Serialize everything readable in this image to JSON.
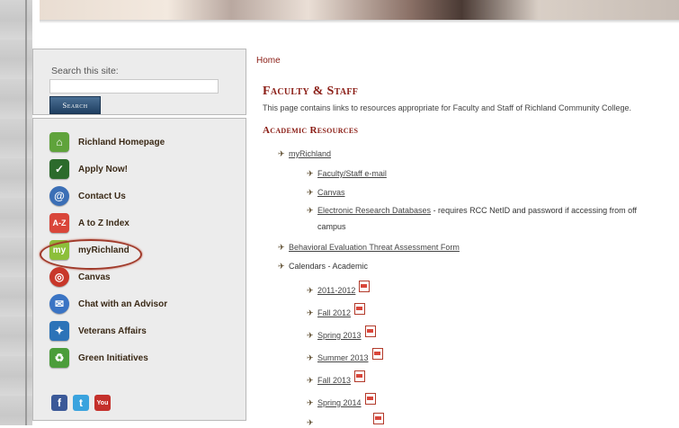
{
  "search": {
    "label": "Search this site:",
    "placeholder": "",
    "button_label": "Search"
  },
  "sidebar": {
    "items": [
      {
        "label": "Richland Homepage",
        "icon": "home-icon",
        "color": "#5fa33b"
      },
      {
        "label": "Apply Now!",
        "icon": "checkmark-icon",
        "color": "#2c6b2c"
      },
      {
        "label": "Contact Us",
        "icon": "at-sign-icon",
        "color": "#3b6fb6"
      },
      {
        "label": "A to Z Index",
        "icon": "az-index-icon",
        "color": "#d9463a"
      },
      {
        "label": "myRichland",
        "icon": "myrichland-icon",
        "color": "#8cbf3a"
      },
      {
        "label": "Canvas",
        "icon": "canvas-icon",
        "color": "#c8372a"
      },
      {
        "label": "Chat with an Advisor",
        "icon": "chat-icon",
        "color": "#3a74c4"
      },
      {
        "label": "Veterans Affairs",
        "icon": "ribbon-icon",
        "color": "#2c73b8"
      },
      {
        "label": "Green Initiatives",
        "icon": "recycle-icon",
        "color": "#4b9d3a"
      }
    ],
    "social": [
      {
        "label": "f",
        "icon": "facebook-icon",
        "color": "#3b5998"
      },
      {
        "label": "t",
        "icon": "twitter-icon",
        "color": "#3aa3de"
      },
      {
        "label": "You",
        "icon": "youtube-icon",
        "color": "#c4302b"
      }
    ]
  },
  "main": {
    "breadcrumb": "Home",
    "title": "Faculty & Staff",
    "description": "This page contains links to resources appropriate for Faculty and Staff of Richland Community College.",
    "section_heading": "Academic Resources",
    "items": {
      "myrichland": "myRichland",
      "email": "Faculty/Staff e-mail",
      "canvas": "Canvas",
      "databases": "Electronic Research Databases",
      "databases_note_1": " - requires RCC NetID and password if accessing from off",
      "databases_note_2": "campus",
      "threat_form": "Behavioral Evaluation Threat Assessment Form",
      "calendars": "Calendars - Academic",
      "cal_2011": "2011-2012",
      "cal_fall2012": "Fall 2012",
      "cal_spring2013": "Spring 2013",
      "cal_summer2013": "Summer 2013",
      "cal_fall2013": "Fall 2013",
      "cal_spring2014": "Spring 2014"
    }
  },
  "colors": {
    "accent": "#8a1c14",
    "highlight_ring": "#a03a2a",
    "search_button": "#1f3f61"
  }
}
